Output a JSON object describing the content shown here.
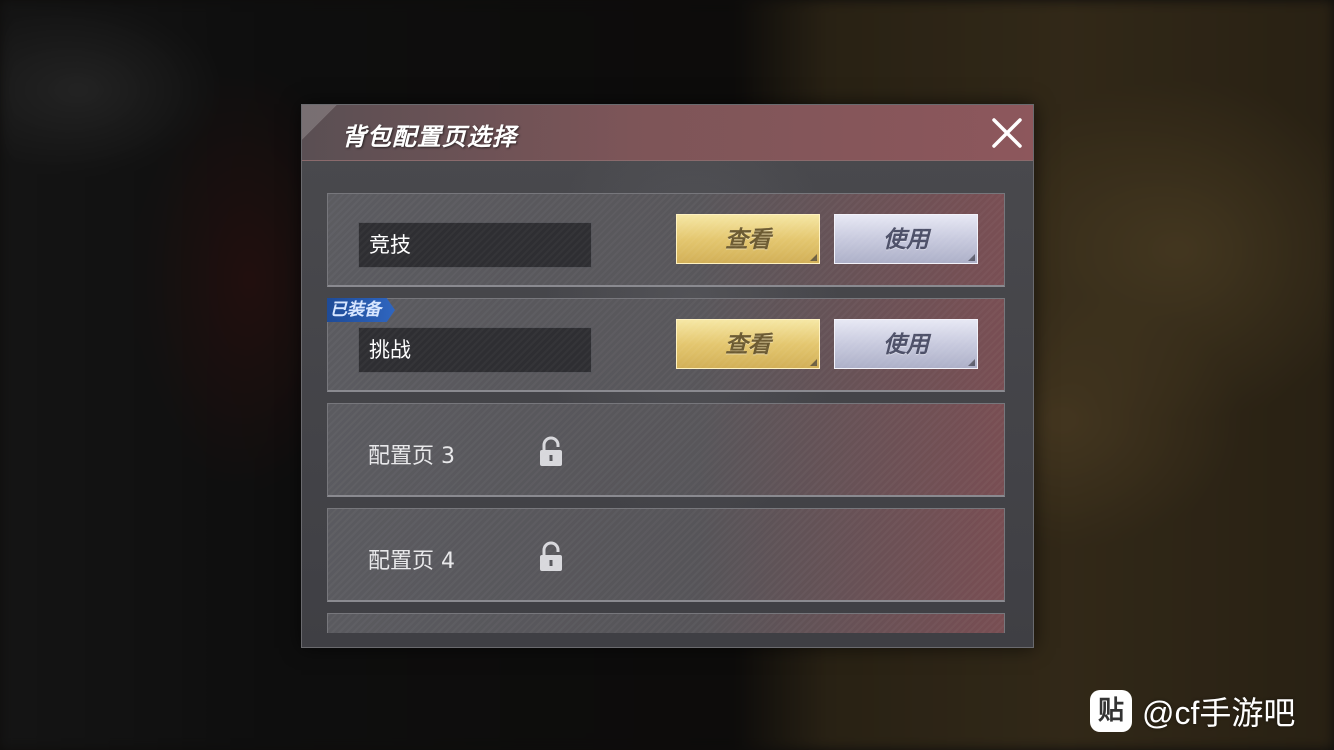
{
  "dialog": {
    "title": "背包配置页选择",
    "close_icon": "close-icon"
  },
  "loadouts": [
    {
      "name": "竞技",
      "equipped": false,
      "view_label": "查看",
      "use_label": "使用"
    },
    {
      "name": "挑战",
      "equipped": true,
      "equipped_label": "已装备",
      "view_label": "查看",
      "use_label": "使用"
    }
  ],
  "locked_pages": [
    {
      "label": "配置页 3",
      "icon": "lock-icon"
    },
    {
      "label": "配置页 4",
      "icon": "lock-icon"
    }
  ],
  "watermark": {
    "logo_text": "贴",
    "text": "@cf手游吧"
  },
  "colors": {
    "view_button": "#e4c770",
    "use_button": "#c8cade",
    "equipped_tag": "#2f66c0",
    "header": "#7d5558"
  }
}
